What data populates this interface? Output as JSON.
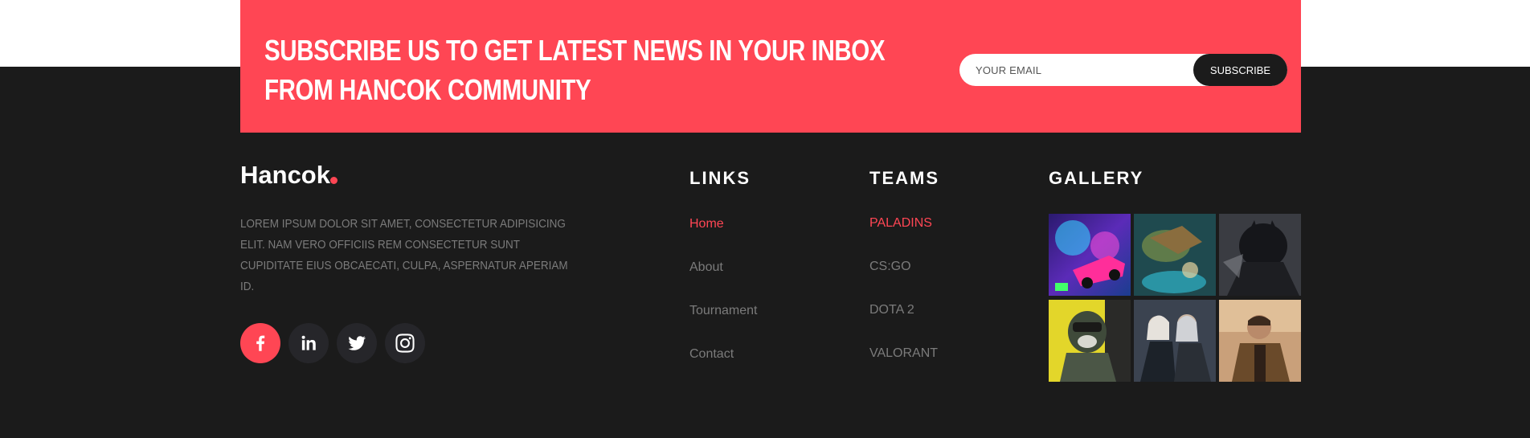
{
  "subscribe": {
    "title_line1": "SUBSCRIBE US TO GET LATEST NEWS IN YOUR INBOX",
    "title_line2": "FROM HANCOK COMMUNITY",
    "email_placeholder": "YOUR EMAIL",
    "button_label": "SUBSCRIBE"
  },
  "brand": {
    "name": "Hancok",
    "description": "LOREM IPSUM DOLOR SIT AMET, CONSECTETUR ADIPISICING ELIT. NAM VERO OFFICIIS REM CONSECTETUR SUNT CUPIDITATE EIUS OBCAECATI, CULPA, ASPERNATUR APERIAM ID."
  },
  "social": [
    {
      "icon": "facebook-icon"
    },
    {
      "icon": "linkedin-icon"
    },
    {
      "icon": "twitter-icon"
    },
    {
      "icon": "instagram-icon"
    }
  ],
  "links": {
    "title": "LINKS",
    "items": [
      "Home",
      "About",
      "Tournament",
      "Contact"
    ]
  },
  "teams": {
    "title": "TEAMS",
    "items": [
      "PALADINS",
      "CS:GO",
      "DOTA 2",
      "VALORANT"
    ]
  },
  "gallery": {
    "title": "GALLERY",
    "images": [
      "rocket-league-car-image",
      "dragon-battle-image",
      "batman-image",
      "call-of-duty-soldier-image",
      "witcher-characters-image",
      "gta-niko-image"
    ]
  },
  "colors": {
    "accent": "#ff4654",
    "footer_bg": "#1b1b1b",
    "social_bg": "#26262a",
    "muted_text": "#7b7b7b"
  }
}
